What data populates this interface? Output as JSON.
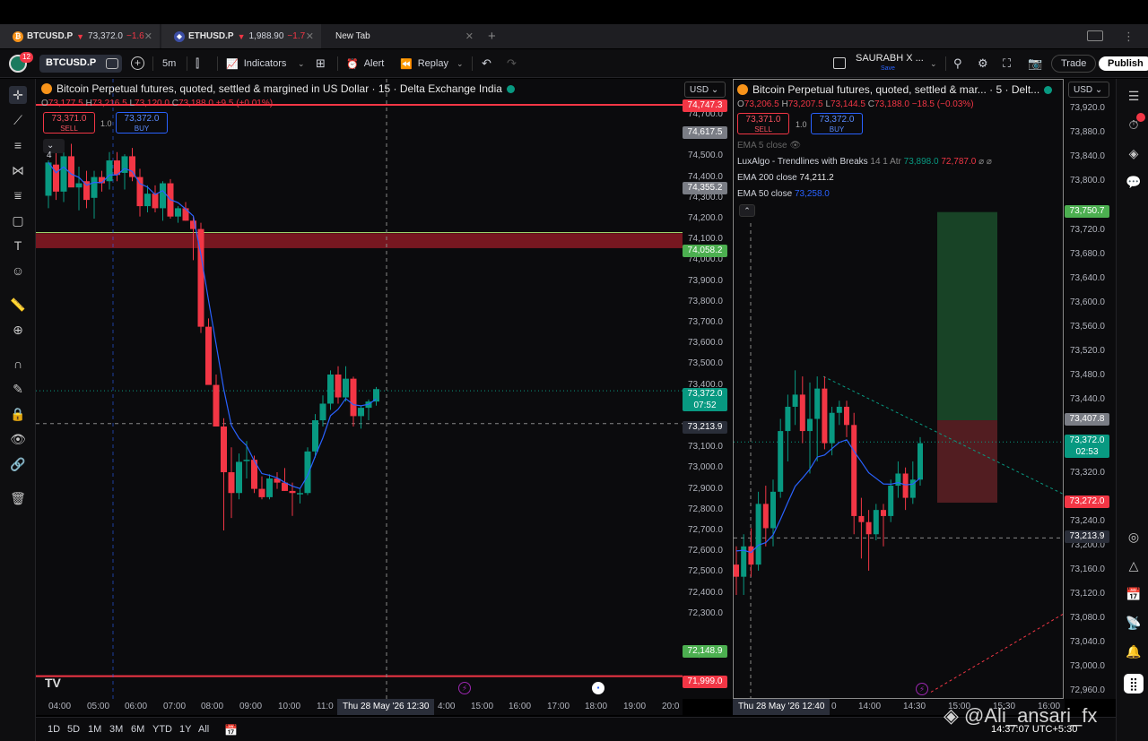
{
  "tabs": [
    {
      "coin": "₿",
      "symbol": "BTCUSD.P",
      "arrow": "▼",
      "price": "73,372.0",
      "change": "−1.6",
      "close": "✕"
    },
    {
      "coin": "◆",
      "symbol": "ETHUSD.P",
      "arrow": "▼",
      "price": "1,988.90",
      "change": "−1.7",
      "close": "✕"
    },
    {
      "symbol": "New Tab",
      "close": "✕"
    }
  ],
  "new_tab_plus": "+",
  "toolbar": {
    "notif_count": "12",
    "symbol": "BTCUSD.P",
    "interval": "5m",
    "indicators": "Indicators",
    "alert": "Alert",
    "replay": "Replay",
    "layout_name": "SAURABH X ...",
    "layout_sub": "Save",
    "trade": "Trade",
    "publish": "Publish"
  },
  "pane1": {
    "title": "Bitcoin Perpetual futures, quoted, settled & margined in US Dollar · 15 · Delta Exchange India",
    "ohlc": {
      "o": "73,177.5",
      "h": "73,216.5",
      "l": "73,120.0",
      "c": "73,188.0",
      "chg": "+9.5 (+0.01%)"
    },
    "sell_price": "73,371.0",
    "sell_label": "SELL",
    "buy_price": "73,372.0",
    "buy_label": "BUY",
    "qty": "1.0",
    "collapse_count": "4",
    "currency": "USD",
    "price_ticks": [
      "74,700.0",
      "74,500.0",
      "74,400.0",
      "74,300.0",
      "74,200.0",
      "74,100.0",
      "74,000.0",
      "73,900.0",
      "73,800.0",
      "73,700.0",
      "73,600.0",
      "73,500.0",
      "73,400.0",
      "73,100.0",
      "73,000.0",
      "72,900.0",
      "72,800.0",
      "72,700.0",
      "72,600.0",
      "72,500.0",
      "72,400.0",
      "72,300.0",
      "72,100.0"
    ],
    "labels": {
      "top_red": "74,747.3",
      "grey1": "74,617.5",
      "grey2": "74,355.2",
      "green_zone": "74,058.2",
      "last_price": "73,372.0",
      "countdown": "07:52",
      "crosshair": "73,213.9",
      "green_low": "72,148.9",
      "bottom_red": "71,999.0"
    },
    "time_ticks": [
      "04:00",
      "05:00",
      "06:00",
      "07:00",
      "08:00",
      "09:00",
      "10:00",
      "11:0",
      "4:00",
      "15:00",
      "16:00",
      "17:00",
      "18:00",
      "19:00",
      "20:0"
    ],
    "cross_date": "Thu 28 May '26   12:30"
  },
  "pane2": {
    "title": "Bitcoin Perpetual futures, quoted, settled & mar... · 5 · Delt...",
    "ohlc": {
      "o": "73,206.5",
      "h": "73,207.5",
      "l": "73,144.5",
      "c": "73,188.0",
      "chg": "−18.5 (−0.03%)"
    },
    "sell_price": "73,371.0",
    "sell_label": "SELL",
    "buy_price": "73,372.0",
    "buy_label": "BUY",
    "qty": "1.0",
    "currency": "USD",
    "indicators": [
      {
        "name": "EMA 5 close"
      },
      {
        "name": "LuxAlgo - Trendlines with Breaks",
        "params": "14 1 Atr",
        "v1": "73,898.0",
        "v2": "72,787.0"
      },
      {
        "name": "EMA 200 close",
        "value": "74,211.2"
      },
      {
        "name": "EMA 50 close",
        "value": "73,258.0"
      }
    ],
    "price_ticks": [
      "73,920.0",
      "73,880.0",
      "73,840.0",
      "73,800.0",
      "73,720.0",
      "73,680.0",
      "73,640.0",
      "73,600.0",
      "73,560.0",
      "73,520.0",
      "73,480.0",
      "73,440.0",
      "73,320.0",
      "73,240.0",
      "73,200.0",
      "73,160.0",
      "73,120.0",
      "73,080.0",
      "73,040.0",
      "73,000.0",
      "72,960.0"
    ],
    "labels": {
      "target": "73,750.7",
      "entry": "73,407.8",
      "last_price": "73,372.0",
      "countdown": "02:53",
      "stop": "73,272.0",
      "crosshair": "73,213.9"
    },
    "time_ticks": [
      "0",
      "14:00",
      "14:30",
      "15:00",
      "15:30",
      "16:00"
    ],
    "cross_date": "Thu 28 May '26   12:40"
  },
  "periods": [
    "1D",
    "5D",
    "1M",
    "3M",
    "6M",
    "YTD",
    "1Y",
    "All"
  ],
  "clock": "14:37:07 UTC+5:30",
  "watermark": "@Ali_ansari_fx",
  "colors": {
    "up": "#089981",
    "down": "#f23645",
    "ema": "#2962ff",
    "zone": "#8b1a24"
  }
}
